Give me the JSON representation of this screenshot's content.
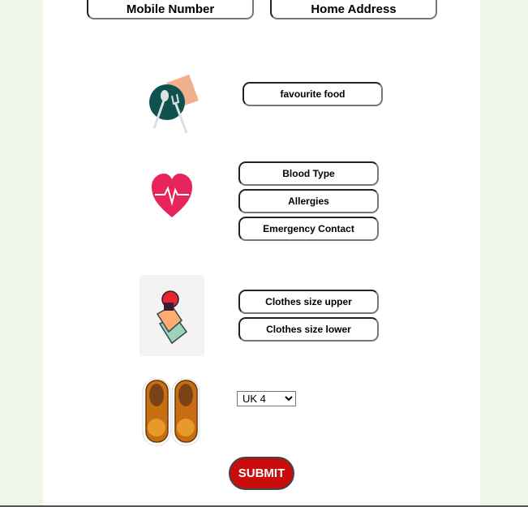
{
  "contact": {
    "mobile_placeholder": "Mobile Number",
    "address_placeholder": "Home Address"
  },
  "food": {
    "icon": "plate-cutlery-icon",
    "placeholder": "favourite food"
  },
  "medical": {
    "icon": "heart-pulse-icon",
    "blood_type_placeholder": "Blood Type",
    "allergies_placeholder": "Allergies",
    "emergency_placeholder": "Emergency Contact"
  },
  "clothes": {
    "icon": "clothes-stack-icon",
    "upper_placeholder": "Clothes size upper",
    "lower_placeholder": "Clothes size lower"
  },
  "shoes": {
    "icon": "shoes-icon",
    "selected_size": "UK 4"
  },
  "submit_label": "SUBMIT",
  "colors": {
    "submit": "#c90d0d",
    "side_background": "#eff5e9"
  }
}
